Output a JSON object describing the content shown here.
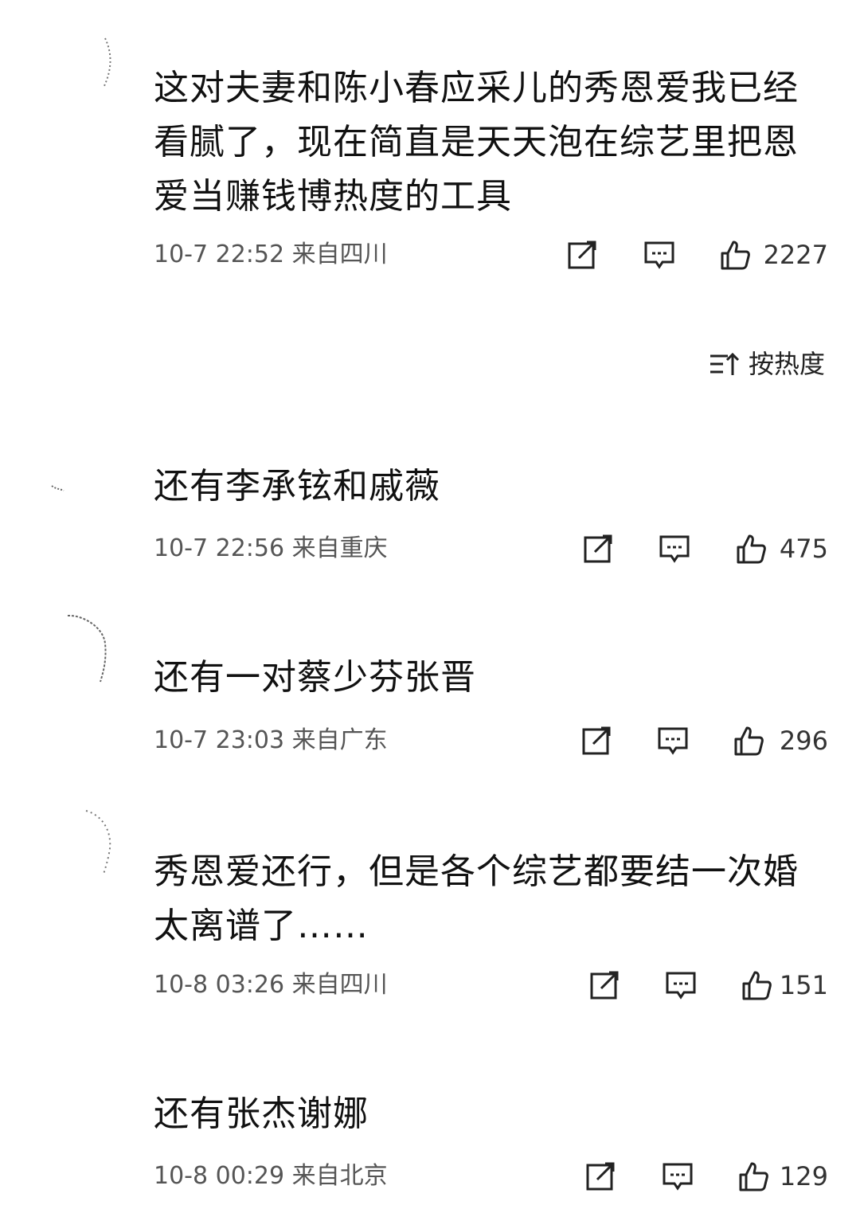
{
  "comments": [
    {
      "text": "这对夫妻和陈小春应采儿的秀恩爱我已经看腻了，现在简直是天天泡在综艺里把恩爱当赚钱博热度的工具",
      "time": "10-7 22:52 来自四川",
      "likes": "2227"
    },
    {
      "text": "还有李承铉和戚薇",
      "time": "10-7 22:56 来自重庆",
      "likes": "475"
    },
    {
      "text": "还有一对蔡少芬张晋",
      "time": "10-7 23:03 来自广东",
      "likes": "296"
    },
    {
      "text": "秀恩爱还行，但是各个综艺都要结一次婚太离谱了……",
      "time": "10-8 03:26 来自四川",
      "likes": "151"
    },
    {
      "text": "还有张杰谢娜",
      "time": "10-8 00:29 来自北京",
      "likes": "129"
    }
  ],
  "sort": {
    "label": "按热度",
    "icon": "sort-icon"
  },
  "icons": {
    "share": "share-icon",
    "reply": "comment-icon",
    "like": "thumbs-up-icon"
  }
}
